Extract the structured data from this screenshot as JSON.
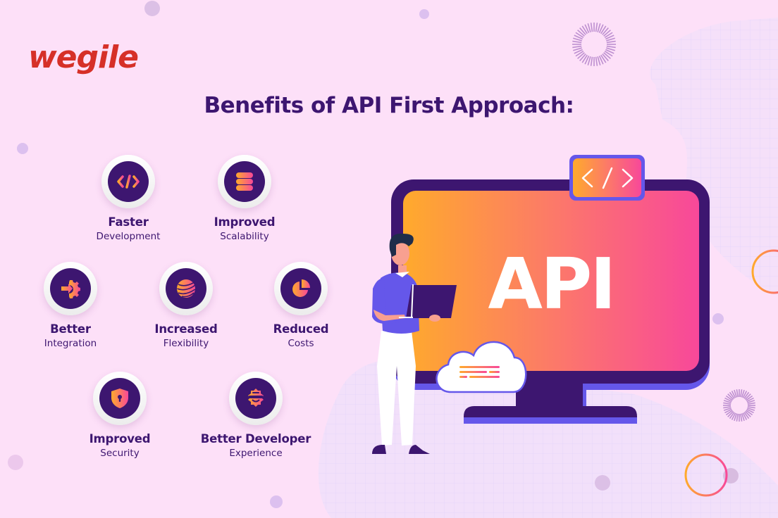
{
  "brand": {
    "logo_text": "wegile",
    "logo_color": "#d63028"
  },
  "header": {
    "title": "Benefits of API First Approach:"
  },
  "colors": {
    "background": "#fde0f8",
    "primary_dark": "#3d1670",
    "accent_purple": "#6557ea",
    "gradient_start": "#ffaa2c",
    "gradient_end": "#f84898"
  },
  "benefits": [
    {
      "title": "Faster",
      "subtitle": "Development",
      "icon": "code-icon"
    },
    {
      "title": "Improved",
      "subtitle": "Scalability",
      "icon": "database-icon"
    },
    {
      "title": "Better",
      "subtitle": "Integration",
      "icon": "gear-integration-icon"
    },
    {
      "title": "Increased",
      "subtitle": "Flexibility",
      "icon": "globe-icon"
    },
    {
      "title": "Reduced",
      "subtitle": "Costs",
      "icon": "pie-chart-icon"
    },
    {
      "title": "Improved",
      "subtitle": "Security",
      "icon": "shield-lock-icon"
    },
    {
      "title": "Better Developer",
      "subtitle": "Experience",
      "icon": "developer-gear-icon"
    }
  ],
  "illustration": {
    "screen_text": "API",
    "code_tag_text": "</>"
  }
}
